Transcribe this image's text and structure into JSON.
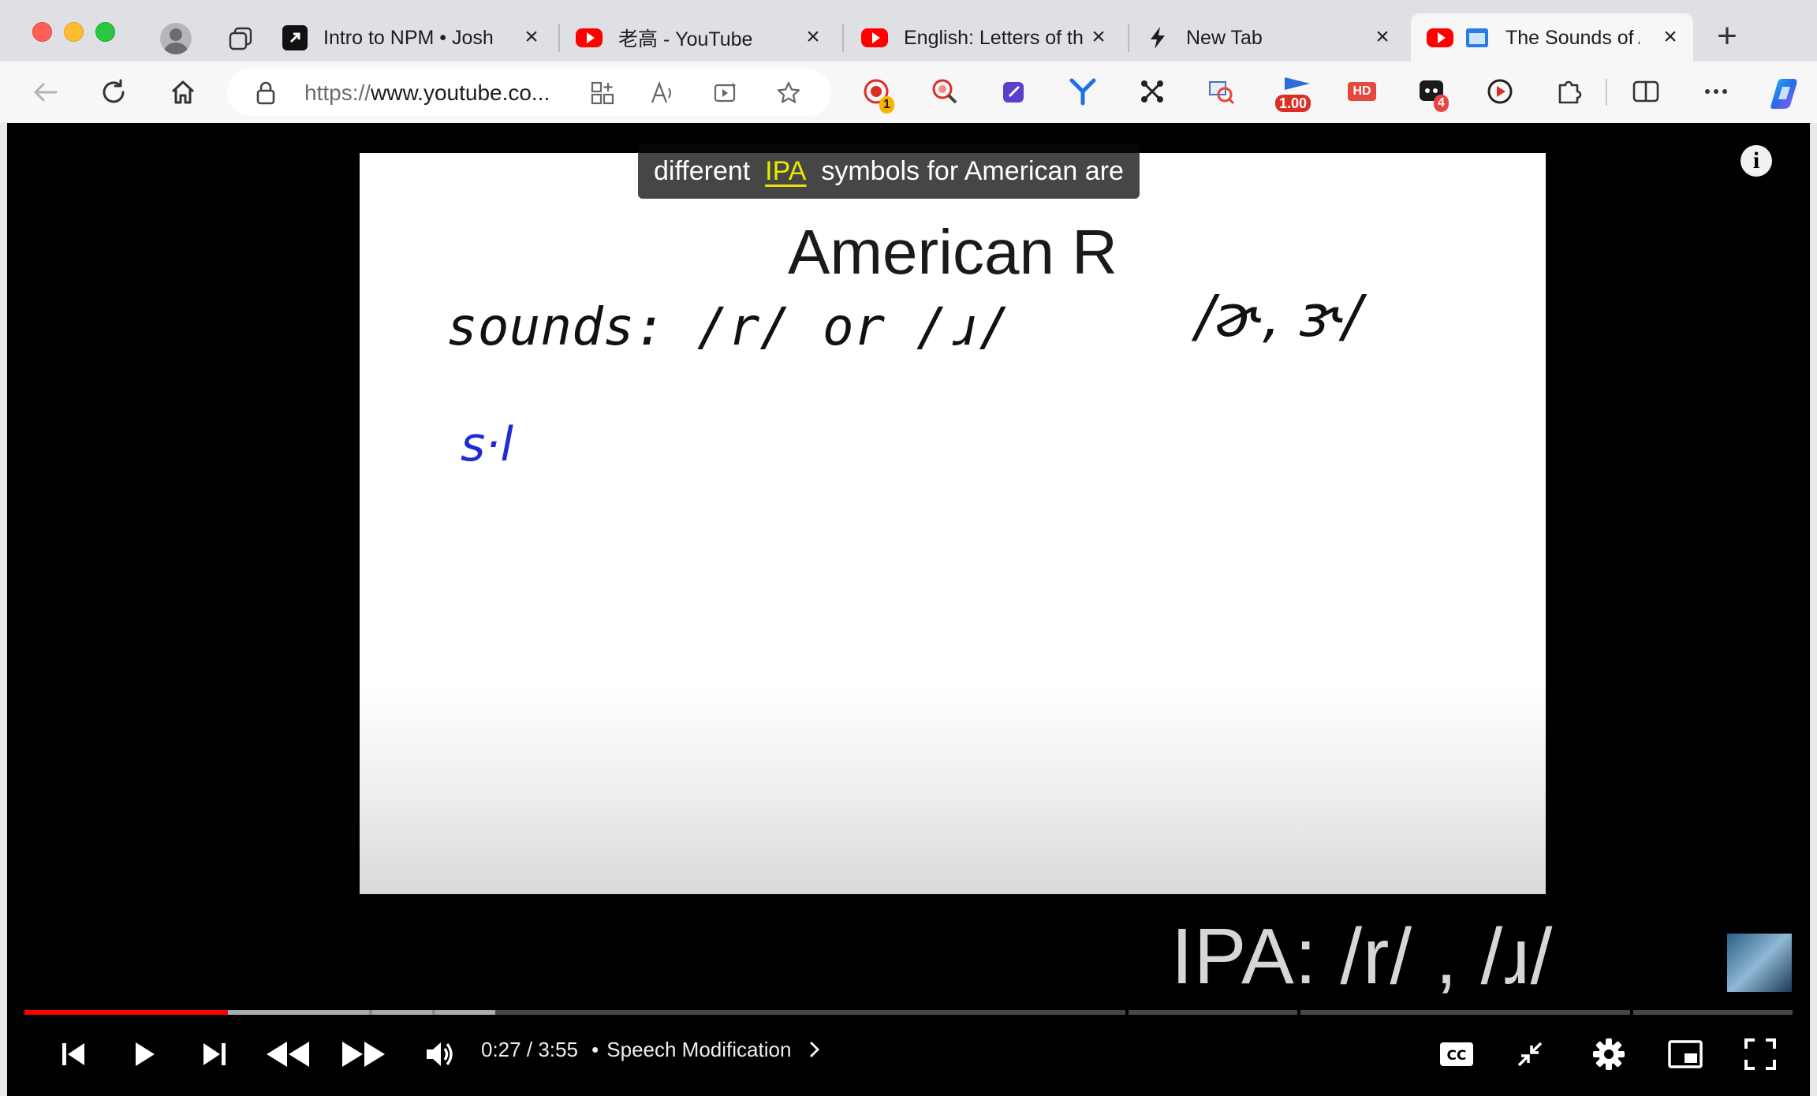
{
  "browser": {
    "tabs": [
      {
        "label": "Intro to NPM • Josh",
        "icon": "arrow-up-right-icon",
        "active": false
      },
      {
        "label": "老高 - YouTube",
        "icon": "youtube-icon",
        "active": false
      },
      {
        "label": "English: Letters of th",
        "icon": "youtube-icon",
        "active": false
      },
      {
        "label": "New Tab",
        "icon": "bolt-icon",
        "active": false
      },
      {
        "label": "The Sounds of A",
        "icon": "youtube-icon",
        "active": true
      }
    ],
    "address": {
      "protocol": "https://",
      "host": "www.youtube.co..."
    },
    "extension_badges": {
      "record": "1",
      "speed": "1.00",
      "notes": "4"
    },
    "hd_label": "HD"
  },
  "video": {
    "caption_before": "different",
    "caption_highlight": "IPA",
    "caption_after": "symbols for American are",
    "slide_title": "American R",
    "handwriting_line1": "sounds: /r/ or /ɹ/",
    "handwriting_line1_right": "/ɚ, ɝ/",
    "handwriting_blue": "s·l",
    "ipa_overlay": "IPA: /r/ , /ɹ/",
    "info_icon": "i",
    "current_time": "0:27",
    "duration": "3:55",
    "separator": "/",
    "bullet": "•",
    "chapter": "Speech Modification",
    "played_fraction": 0.115,
    "colors": {
      "played": "#ff0000",
      "caption_highlight": "#e8e800",
      "handwriting_blue": "#1f2bd6"
    }
  }
}
